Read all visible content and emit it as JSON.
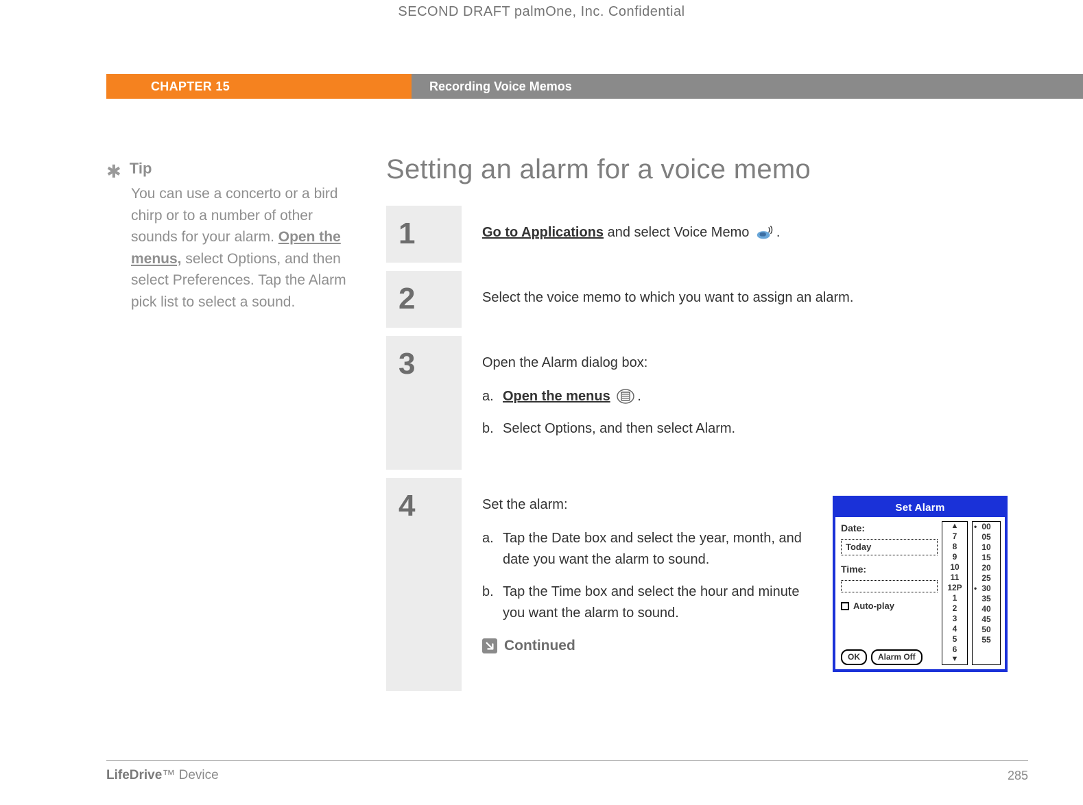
{
  "watermark": "SECOND DRAFT palmOne, Inc.  Confidential",
  "header": {
    "chapter": "CHAPTER 15",
    "title": "Recording Voice Memos"
  },
  "tip": {
    "label": "Tip",
    "bodyPre": "You can use a concerto or a bird chirp or to a number of other sounds for your alarm. ",
    "link": "Open the menus,",
    "bodyPost": " select Options, and then select Preferences. Tap the Alarm pick list to select a sound."
  },
  "heading": "Setting an alarm for a voice memo",
  "steps": {
    "s1": {
      "num": "1",
      "link": "Go to Applications",
      "mid": " and select Voice Memo ",
      "tail": "."
    },
    "s2": {
      "num": "2",
      "text": "Select the voice memo to which you want to assign an alarm."
    },
    "s3": {
      "num": "3",
      "intro": "Open the Alarm dialog box:",
      "a_letter": "a.",
      "a_link": "Open the menus",
      "a_tail": ".",
      "b_letter": "b.",
      "b_text": "Select Options, and then select Alarm."
    },
    "s4": {
      "num": "4",
      "intro": "Set the alarm:",
      "a_letter": "a.",
      "a_text": "Tap the Date box and select the year, month, and date you want the alarm to sound.",
      "b_letter": "b.",
      "b_text": "Tap the Time box and select the hour and minute you want the alarm to sound.",
      "continued": "Continued"
    }
  },
  "palm": {
    "title": "Set Alarm",
    "dateLabel": "Date:",
    "dateValue": "Today",
    "timeLabel": "Time:",
    "autoplay": "Auto-play",
    "ok": "OK",
    "alarmOff": "Alarm Off",
    "hours": {
      "h0": "7",
      "h1": "8",
      "h2": "9",
      "h3": "10",
      "h4": "11",
      "h5": "12P",
      "h6": "1",
      "h7": "2",
      "h8": "3",
      "h9": "4",
      "h10": "5",
      "h11": "6"
    },
    "minutes": {
      "m0": "00",
      "m1": "05",
      "m2": "10",
      "m3": "15",
      "m4": "20",
      "m5": "25",
      "m6": "30",
      "m7": "35",
      "m8": "40",
      "m9": "45",
      "m10": "50",
      "m11": "55"
    }
  },
  "footer": {
    "productBold": "LifeDrive",
    "productRest": "™ Device",
    "page": "285"
  }
}
